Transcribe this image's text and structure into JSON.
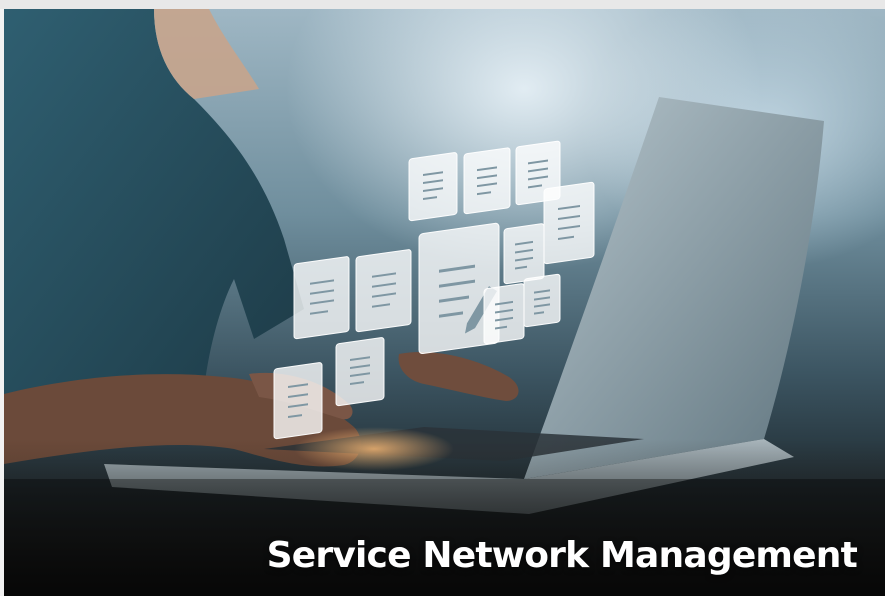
{
  "hero": {
    "caption": "Service Network Management",
    "image_subject": "person-typing-on-laptop-with-floating-document-icons"
  },
  "colors": {
    "caption_text": "#ffffff",
    "shirt": "#3f6f80",
    "laptop": "#8fa2ab",
    "overlay_dark": "#0e1214"
  }
}
